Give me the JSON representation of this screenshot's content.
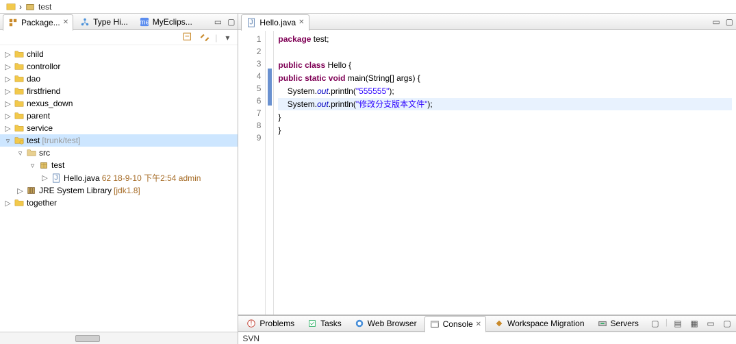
{
  "breadcrumb": {
    "sep": "›",
    "item": "test"
  },
  "leftTabs": [
    {
      "label": "Package...",
      "active": true,
      "hasClose": true
    },
    {
      "label": "Type Hi...",
      "active": false
    },
    {
      "label": "MyEclips...",
      "active": false
    }
  ],
  "tree": {
    "items": [
      {
        "indent": 0,
        "tw": "▷",
        "icon": "folder",
        "label": "child"
      },
      {
        "indent": 0,
        "tw": "▷",
        "icon": "folder",
        "label": "controllor"
      },
      {
        "indent": 0,
        "tw": "▷",
        "icon": "folder",
        "label": "dao"
      },
      {
        "indent": 0,
        "tw": "▷",
        "icon": "folder",
        "label": "firstfriend"
      },
      {
        "indent": 0,
        "tw": "▷",
        "icon": "folder",
        "label": "nexus_down"
      },
      {
        "indent": 0,
        "tw": "▷",
        "icon": "folder",
        "label": "parent"
      },
      {
        "indent": 0,
        "tw": "▷",
        "icon": "folder",
        "label": "service"
      },
      {
        "indent": 0,
        "tw": "▿",
        "icon": "project",
        "label": "test",
        "decor": " [trunk/test]",
        "selected": true
      },
      {
        "indent": 1,
        "tw": "▿",
        "icon": "srcfolder",
        "label": "src"
      },
      {
        "indent": 2,
        "tw": "▿",
        "icon": "package",
        "label": "test"
      },
      {
        "indent": 3,
        "tw": "▷",
        "icon": "java",
        "label": "Hello.java",
        "decor": " 62  18-9-10 下午2:54  admin",
        "decorClass": "brown"
      },
      {
        "indent": 1,
        "tw": "▷",
        "icon": "library",
        "label": "JRE System Library",
        "decor": " [jdk1.8]",
        "decorClass": "brown"
      },
      {
        "indent": 0,
        "tw": "▷",
        "icon": "folder",
        "label": "together"
      }
    ]
  },
  "editor": {
    "tab": "Hello.java",
    "lines": [
      "1",
      "2",
      "3",
      "4",
      "5",
      "6",
      "7",
      "8",
      "9"
    ],
    "code": {
      "l1a": "package",
      "l1b": " test;",
      "l3a": "public class",
      "l3b": " Hello {",
      "l4a": "public static void",
      "l4b": " main(String[] args) {",
      "l5a": "    System.",
      "l5b": "out",
      "l5c": ".println(",
      "l5d": "\"555555\"",
      "l5e": ");",
      "l6a": "    System.",
      "l6b": "out",
      "l6c": ".println(",
      "l6d": "\"修改分支版本文件\"",
      "l6e": ");",
      "l7": "}",
      "l8": "}"
    }
  },
  "bottomTabs": [
    "Problems",
    "Tasks",
    "Web Browser",
    "Console",
    "Workspace Migration",
    "Servers"
  ],
  "bottomActive": 3,
  "status": "SVN"
}
